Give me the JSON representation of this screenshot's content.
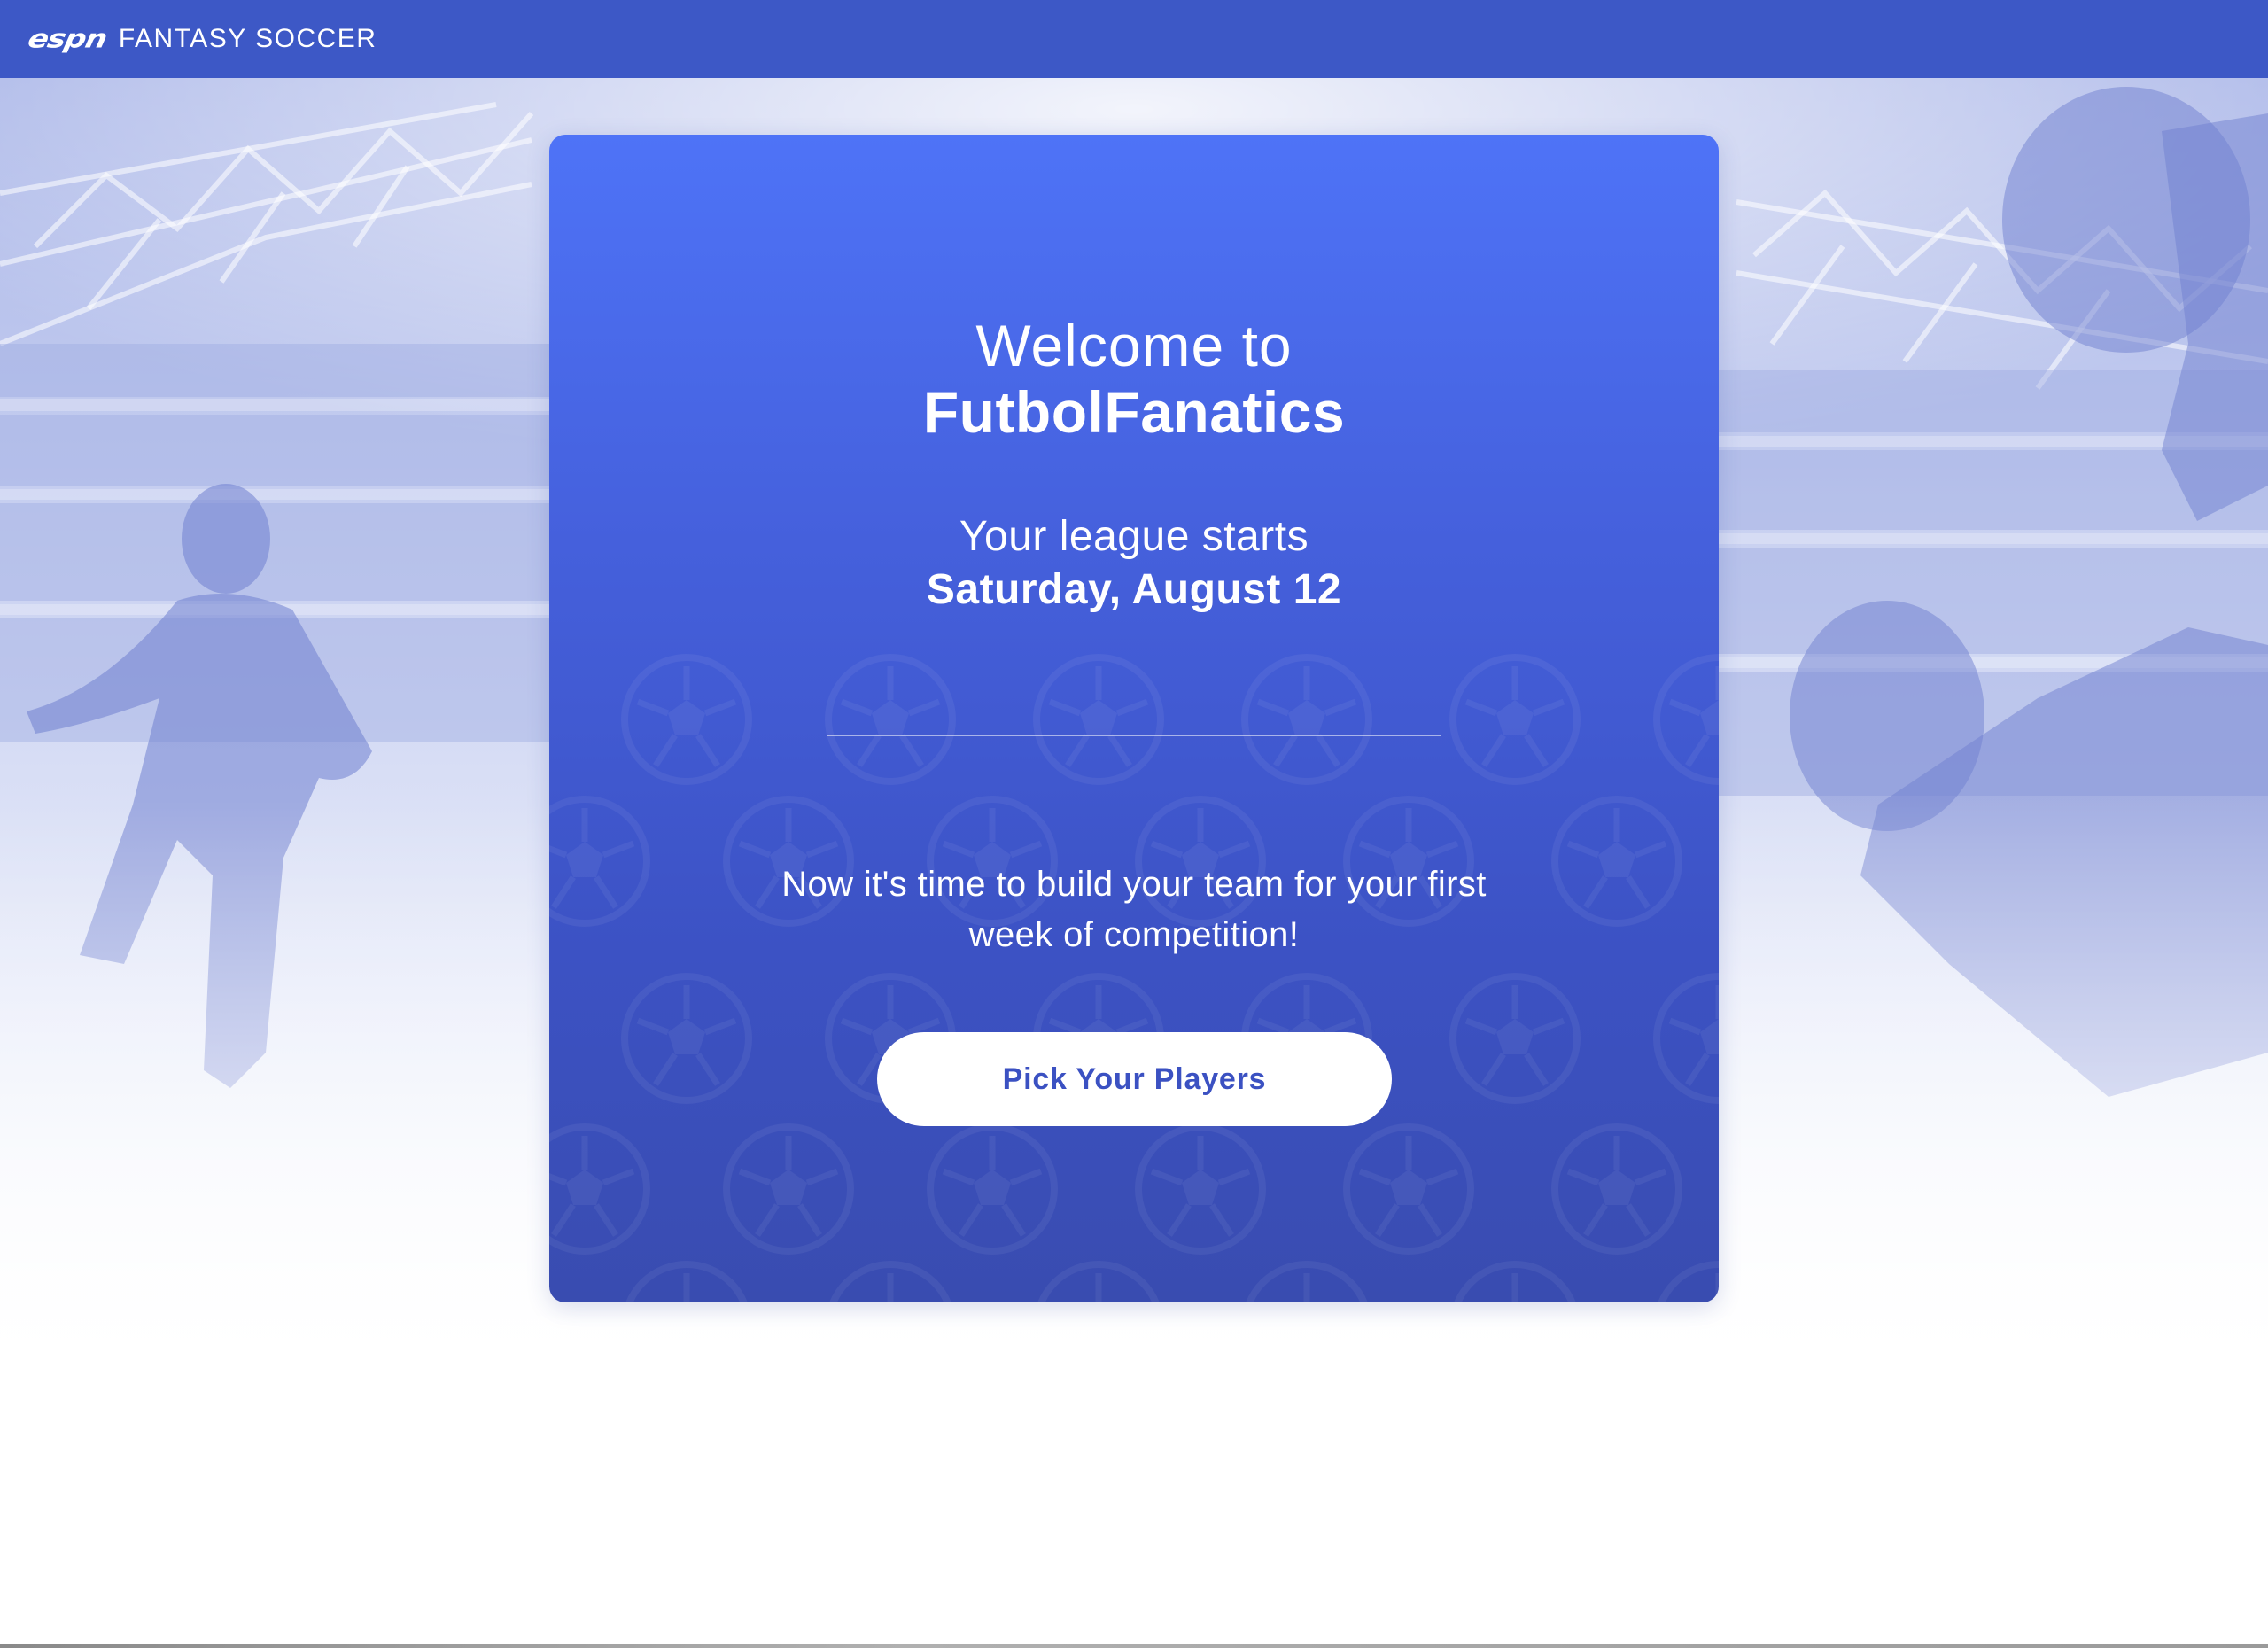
{
  "header": {
    "logo_mark": "espn",
    "brand": "FANTASY SOCCER",
    "background_color": "#3d58c6"
  },
  "welcome_card": {
    "greeting": "Welcome to",
    "league_name": "FutbolFanatics",
    "starts_label": "Your league starts",
    "start_date": "Saturday, August 12",
    "message": "Now it's time to build your team for your first week of competition!",
    "cta_label": "Pick Your Players",
    "card_gradient_top": "#4e73f7",
    "card_gradient_bottom": "#394cb0",
    "cta_text_color": "#3b51c2"
  },
  "background": {
    "scene": "stadium with soccer players, blue-tinted photo fading to white",
    "icons": [
      "soccer-ball-icon"
    ]
  }
}
